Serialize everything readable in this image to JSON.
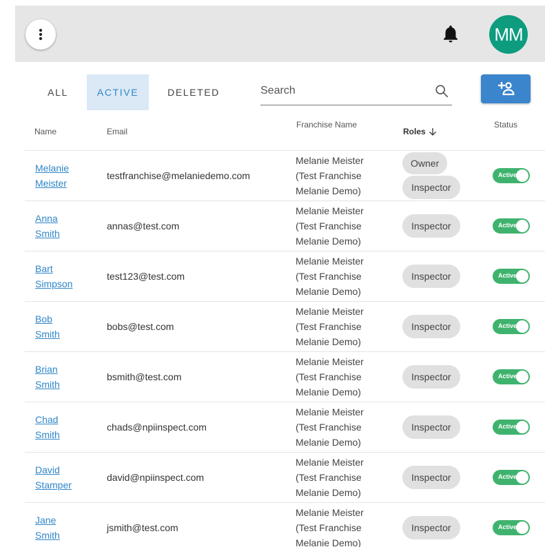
{
  "header": {
    "avatar_initials": "MM",
    "colors": {
      "bar": "#e6e6e6",
      "avatar": "#0e9c7f",
      "accent": "#3a85cc"
    }
  },
  "tabs": {
    "all": "ALL",
    "active": "ACTIVE",
    "deleted": "DELETED"
  },
  "search": {
    "placeholder": "Search"
  },
  "columns": {
    "name": "Name",
    "email": "Email",
    "franchise": "Franchise Name",
    "roles": "Roles",
    "status": "Status"
  },
  "rows": [
    {
      "first": "Melanie",
      "last": "Meister",
      "email": "testfranchise@melaniedemo.com",
      "franchise": [
        "Melanie Meister",
        "(Test Franchise",
        "Melanie Demo)"
      ],
      "roles": [
        "Owner",
        "Inspector"
      ],
      "status": "Active"
    },
    {
      "first": "Anna",
      "last": "Smith",
      "email": "annas@test.com",
      "franchise": [
        "Melanie Meister",
        "(Test Franchise",
        "Melanie Demo)"
      ],
      "roles": [
        "Inspector"
      ],
      "status": "Active"
    },
    {
      "first": "Bart",
      "last": "Simpson",
      "email": "test123@test.com",
      "franchise": [
        "Melanie Meister",
        "(Test Franchise",
        "Melanie Demo)"
      ],
      "roles": [
        "Inspector"
      ],
      "status": "Active"
    },
    {
      "first": "Bob",
      "last": "Smith",
      "email": "bobs@test.com",
      "franchise": [
        "Melanie Meister",
        "(Test Franchise",
        "Melanie Demo)"
      ],
      "roles": [
        "Inspector"
      ],
      "status": "Active"
    },
    {
      "first": "Brian",
      "last": "Smith",
      "email": "bsmith@test.com",
      "franchise": [
        "Melanie Meister",
        "(Test Franchise",
        "Melanie Demo)"
      ],
      "roles": [
        "Inspector"
      ],
      "status": "Active"
    },
    {
      "first": "Chad",
      "last": "Smith",
      "email": "chads@npiinspect.com",
      "franchise": [
        "Melanie Meister",
        "(Test Franchise",
        "Melanie Demo)"
      ],
      "roles": [
        "Inspector"
      ],
      "status": "Active"
    },
    {
      "first": "David",
      "last": "Stamper",
      "email": "david@npiinspect.com",
      "franchise": [
        "Melanie Meister",
        "(Test Franchise",
        "Melanie Demo)"
      ],
      "roles": [
        "Inspector"
      ],
      "status": "Active"
    },
    {
      "first": "Jane",
      "last": "Smith",
      "email": "jsmith@test.com",
      "franchise": [
        "Melanie Meister",
        "(Test Franchise",
        "Melanie Demo)"
      ],
      "roles": [
        "Inspector"
      ],
      "status": "Active"
    }
  ]
}
